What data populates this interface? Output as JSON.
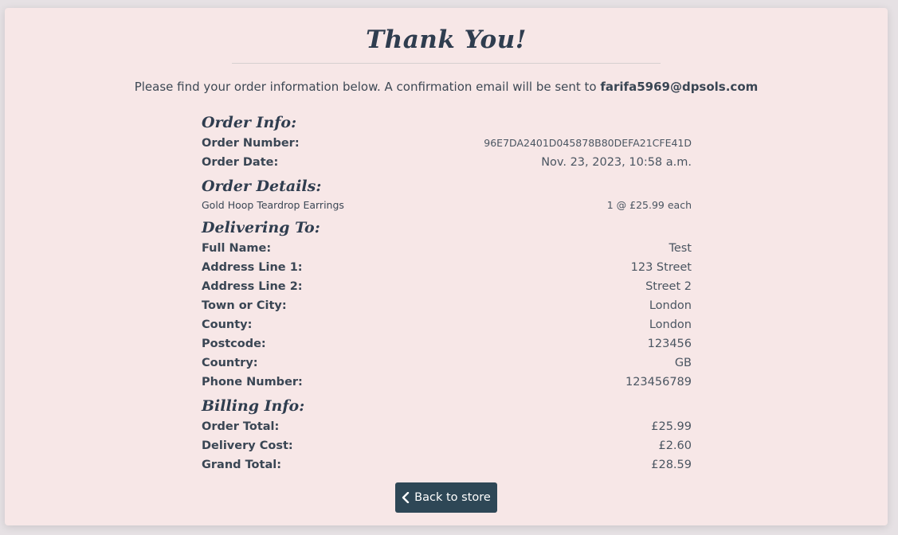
{
  "page": {
    "title": "Thank You!",
    "intro_text": "Please find your order information below. A confirmation email will be sent to ",
    "email": "farifa5969@dpsols.com"
  },
  "order_info": {
    "heading": "Order Info:",
    "rows": [
      {
        "label": "Order Number:",
        "value": "96E7DA2401D045878B80DEFA21CFE41D"
      },
      {
        "label": "Order Date:",
        "value": "Nov. 23, 2023, 10:58 a.m."
      }
    ]
  },
  "order_details": {
    "heading": "Order Details:",
    "items": [
      {
        "name": "Gold Hoop Teardrop Earrings",
        "qty_price": "1 @ £25.99 each"
      }
    ]
  },
  "delivering_to": {
    "heading": "Delivering To:",
    "rows": [
      {
        "label": "Full Name:",
        "value": "Test"
      },
      {
        "label": "Address Line 1:",
        "value": "123 Street"
      },
      {
        "label": "Address Line 2:",
        "value": "Street 2"
      },
      {
        "label": "Town or City:",
        "value": "London"
      },
      {
        "label": "County:",
        "value": "London"
      },
      {
        "label": "Postcode:",
        "value": "123456"
      },
      {
        "label": "Country:",
        "value": "GB"
      },
      {
        "label": "Phone Number:",
        "value": "123456789"
      }
    ]
  },
  "billing_info": {
    "heading": "Billing Info:",
    "rows": [
      {
        "label": "Order Total:",
        "value": "£25.99"
      },
      {
        "label": "Delivery Cost:",
        "value": "£2.60"
      },
      {
        "label": "Grand Total:",
        "value": "£28.59"
      }
    ]
  },
  "actions": {
    "back_label": "Back to store",
    "back_icon": "chevron-left-icon"
  },
  "colors": {
    "card_bg": "#f7e7e7",
    "button_bg": "#2e4756",
    "heading": "#2f3d4f"
  }
}
